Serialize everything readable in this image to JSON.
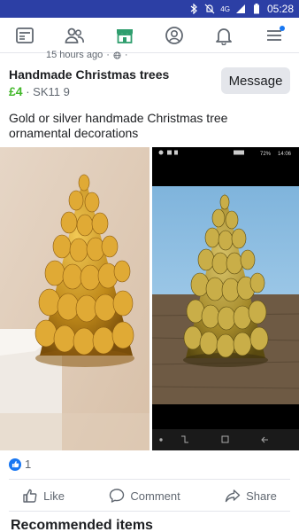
{
  "status_bar": {
    "time": "05:28",
    "network": "4G"
  },
  "nav": {
    "items": [
      {
        "name": "news-feed",
        "icon": "newspaper-icon"
      },
      {
        "name": "friends",
        "icon": "friends-icon"
      },
      {
        "name": "marketplace",
        "icon": "marketplace-shop-icon"
      },
      {
        "name": "profile",
        "icon": "profile-icon"
      },
      {
        "name": "notifications",
        "icon": "bell-icon"
      },
      {
        "name": "menu",
        "icon": "hamburger-icon"
      }
    ],
    "accent": "#1877f2"
  },
  "post": {
    "time": "15 hours ago",
    "title": "Handmade Christmas trees",
    "price": "£4",
    "location": "SK11 9",
    "message_label": "Message",
    "description": "Gold or silver handmade Christmas tree ornamental decorations"
  },
  "embedded_screenshot": {
    "battery": "72%",
    "time": "14:06"
  },
  "reactions": {
    "count": "1"
  },
  "actions": {
    "like": "Like",
    "comment": "Comment",
    "share": "Share"
  },
  "recommended_heading": "Recommended items",
  "colors": {
    "status_bar": "#2c3fa5",
    "price": "#42b72a",
    "gold": "#c89a1e"
  }
}
